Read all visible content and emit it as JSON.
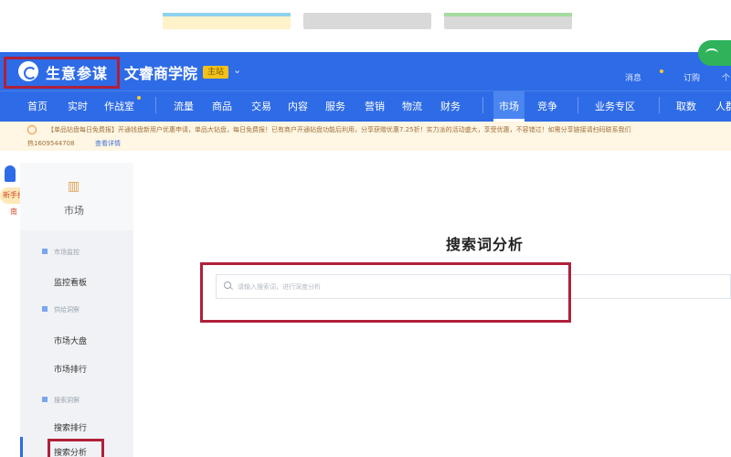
{
  "header": {
    "brand_name": "生意参谋",
    "shop_name": "文睿商学院",
    "shop_badge": "主站",
    "message_label": "消息",
    "order_label": "订购",
    "more_label": "个"
  },
  "nav": {
    "items": [
      "首页",
      "实时",
      "作战室",
      "流量",
      "商品",
      "交易",
      "内容",
      "服务",
      "营销",
      "物流",
      "财务",
      "市场",
      "竞争",
      "业务专区",
      "取数",
      "人群"
    ],
    "active": "市场"
  },
  "notice": {
    "line1": "【单品钻盘每日免费报】开通钱盘新用户优惠申请，单品大钻盘，每日免费报！已有商户开通钻盘功能后利用，分享获赠优惠7.25折！实力派的活动盛大，享受优惠，不容错过！如需分享链接请扫码联系我们",
    "line2": "热1609544708",
    "link": "查看详情"
  },
  "float": {
    "bubble": "新手指南"
  },
  "sidebar": {
    "title": "市场",
    "groups": [
      {
        "label": "市场监控",
        "items": [
          "监控看板"
        ]
      },
      {
        "label": "供给洞察",
        "items": [
          "市场大盘",
          "市场排行"
        ]
      },
      {
        "label": "搜索洞察",
        "items": [
          "搜索排行",
          "搜索分析"
        ]
      }
    ]
  },
  "main": {
    "title": "搜索词分析",
    "search_placeholder": "请输入搜索词，进行深度分析"
  }
}
